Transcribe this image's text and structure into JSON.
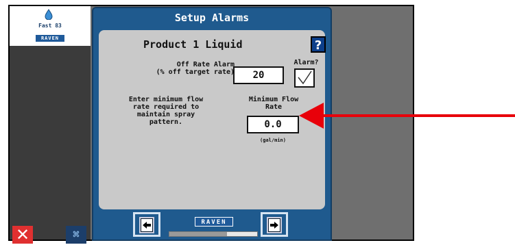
{
  "left_panel": {
    "logo_text": "Fast 83",
    "logo_brand": "RAVEN",
    "close_symbol": "✕",
    "diagram_symbol": "⌘"
  },
  "dialog": {
    "title": "Setup Alarms",
    "product_title": "Product 1 Liquid",
    "help_label": "?",
    "off_rate_label": "Off Rate Alarm\n(% off target rate)",
    "off_rate_value": "20",
    "alarm_label": "Alarm?",
    "alarm_checked": true,
    "instruction": "Enter minimum flow\nrate required to\nmaintain spray\npattern.",
    "min_flow_label": "Minimum Flow\nRate",
    "min_flow_value": "0.0",
    "units": "(gal/min)",
    "footer_brand": "RAVEN",
    "progress_fraction": 0.66
  },
  "colors": {
    "dialog_blue": "#1f5a8e",
    "arrow_red": "#e8000a"
  }
}
